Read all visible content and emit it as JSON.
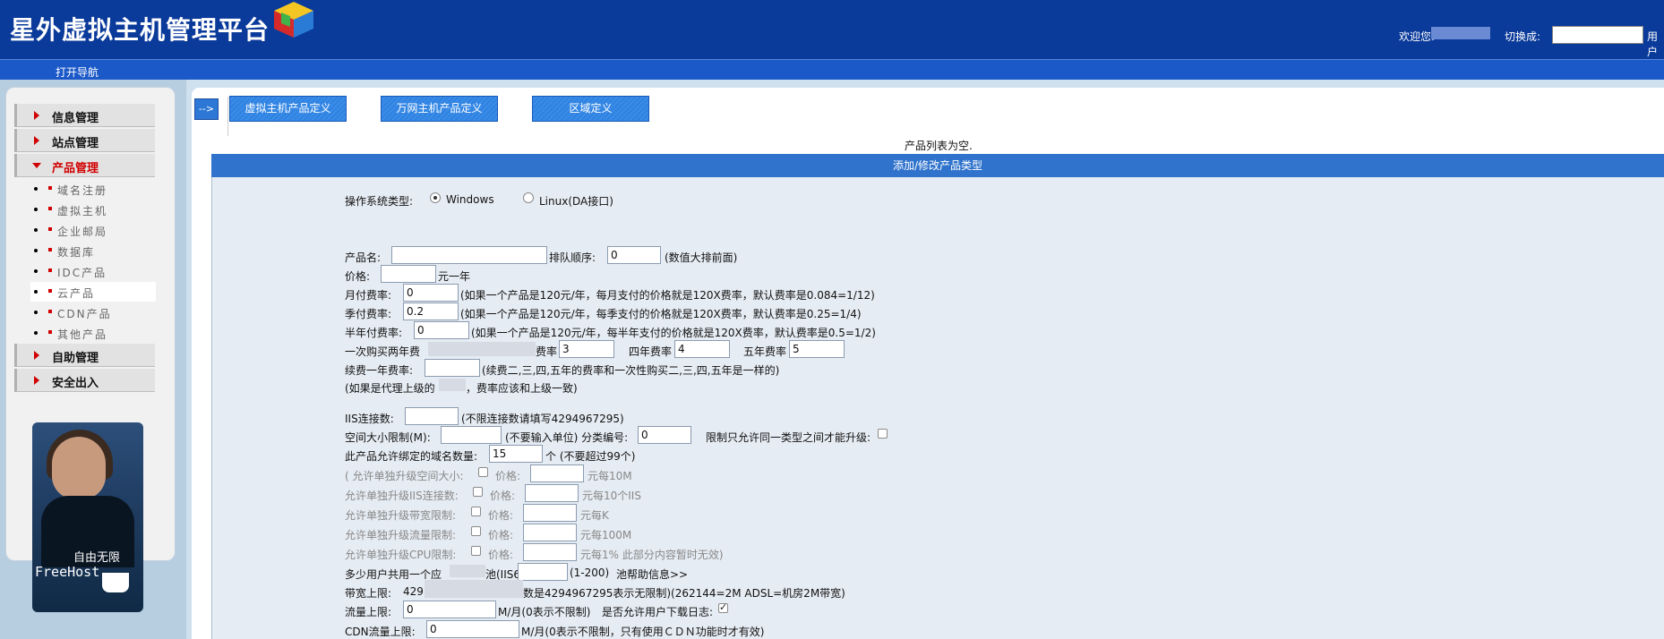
{
  "header": {
    "title": "星外虚拟主机管理平台",
    "welcome": "欢迎您:",
    "switch_label": "切换成:",
    "user_label": "用户"
  },
  "navbar": {
    "open_nav": "打开导航"
  },
  "sidebar": {
    "groups": [
      {
        "label": "信息管理"
      },
      {
        "label": "站点管理"
      },
      {
        "label": "产品管理",
        "expanded": true
      },
      {
        "label": "自助管理"
      },
      {
        "label": "安全出入"
      }
    ],
    "product_items": [
      "域名注册",
      "虚拟主机",
      "企业邮局",
      "数据库",
      "IDC产品",
      "云产品",
      "CDN产品",
      "其他产品"
    ],
    "selected_item": "云产品"
  },
  "ad": {
    "line1": "自由无限",
    "line2": "FreeHost"
  },
  "toolbar": {
    "arrow": "-->",
    "tabs": [
      "虚拟主机产品定义",
      "万网主机产品定义",
      "区域定义"
    ]
  },
  "empty_text": "产品列表为空.",
  "form": {
    "header": "添加/修改产品类型",
    "os_label": "操作系统类型:",
    "os_options": [
      "Windows",
      "Linux(DA接口)"
    ],
    "os_selected": "Windows",
    "name_label": "产品名:",
    "order_label": "排队顺序:",
    "order_value": "0",
    "order_hint": "(数值大排前面)",
    "price_label": "价格:",
    "price_unit": "元一年",
    "monthly_label": "月付费率:",
    "monthly_value": "0",
    "monthly_hint": "(如果一个产品是120元/年，每月支付的价格就是120X费率，默认费率是0.084=1/12)",
    "quarterly_label": "季付费率:",
    "quarterly_value": "0.2",
    "quarterly_hint": "(如果一个产品是120元/年，每季支付的价格就是120X费率，默认费率是0.25=1/4)",
    "half_label": "半年付费率:",
    "half_value": "0",
    "half_hint": "(如果一个产品是120元/年，每半年支付的价格就是120X费率，默认费率是0.5=1/2)",
    "once_label": "一次购买两年费",
    "rate_suffix": "费率",
    "three_value": "3",
    "four_label": "四年费率",
    "four_value": "4",
    "five_label": "五年费率",
    "five_value": "5",
    "renew_label": "续费一年费率:",
    "renew_hint": "(续费二,三,四,五年的费率和一次性购买二,三,四,五年是一样的)",
    "agent_hint_a": "(如果是代理上级的",
    "agent_hint_b": "，费率应该和上级一致)",
    "iis_label": "IIS连接数:",
    "iis_hint": "(不限连接数请填写4294967295)",
    "space_label": "空间大小限制(M):",
    "space_hint": "(不要输入单位) 分类编号:",
    "category_value": "0",
    "same_type_label": "限制只允许同一类型之间才能升级:",
    "domain_count_label": "此产品允许绑定的域名数量:",
    "domain_count_value": "15",
    "domain_count_hint": "个 (不要超过99个)",
    "upgrades": [
      {
        "label": "( 允许单独升级空间大小:",
        "price": "价格:",
        "unit": "元每10M"
      },
      {
        "label": "允许单独升级IIS连接数:",
        "price": "价格:",
        "unit": "元每10个IIS"
      },
      {
        "label": "允许单独升级带宽限制:",
        "price": "价格:",
        "unit": "元每K"
      },
      {
        "label": "允许单独升级流量限制:",
        "price": "价格:",
        "unit": "元每100M"
      },
      {
        "label": "允许单独升级CPU限制:",
        "price": "价格:",
        "unit": "元每1% 此部分内容暂时无效)"
      }
    ],
    "pool_label": "多少用户共用一个应",
    "pool_label_b": "池(IIS6):",
    "pool_hint": "(1-200)",
    "pool_help": "池帮助信息>>",
    "bandwidth_label": "带宽上限:",
    "bandwidth_value": "429",
    "bandwidth_hint": "数是4294967295表示无限制)(262144=2M ADSL=机房2M带宽)",
    "traffic_label": "流量上限:",
    "traffic_value": "0",
    "traffic_hint": "M/月(0表示不限制)",
    "log_label": "是否允许用户下载日志:",
    "cdn_label": "CDN流量上限:",
    "cdn_value": "0",
    "cdn_hint": "M/月(0表示不限制，只有使用ＣＤＮ功能时才有效)"
  }
}
